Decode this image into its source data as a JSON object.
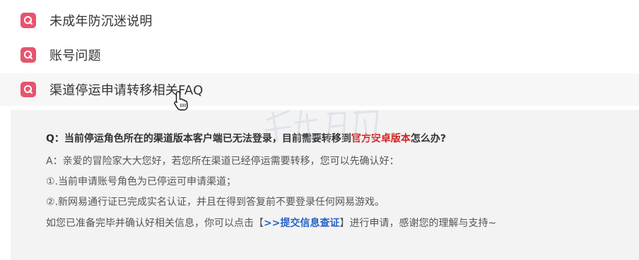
{
  "faq": {
    "items": [
      {
        "badge": "Q",
        "title": "未成年防沉迷说明"
      },
      {
        "badge": "Q",
        "title": "账号问题"
      },
      {
        "badge": "Q",
        "title": "渠道停运申请转移相关FAQ"
      }
    ]
  },
  "answer": {
    "question_prefix": "Q：当前停运角色所在的渠道版本客户端已无法登录，目前需要转移到",
    "question_highlight": "官方安卓版本",
    "question_suffix": "怎么办?",
    "line1": "A：亲爱的冒险家大大您好，若您所在渠道已经停运需要转移，您可以先确认好：",
    "line2": "①.当前申请账号角色为已停运可申请渠道；",
    "line3": "②.新网易通行证已完成实名认证，并且在得到答复前不要登录任何网易游戏。",
    "line4_prefix": "如您已准备完毕并确认好相关信息，你可以点击",
    "line4_bracket_open": "【",
    "line4_link": ">>提交信息查证",
    "line4_bracket_close": "】",
    "line4_suffix": "进行申请，感谢您的理解与支持~"
  },
  "colors": {
    "badge": "#e7546e",
    "highlight": "#d81e1e",
    "link": "#2a62c9",
    "panel_bg": "#f3f3f3"
  },
  "icons": {
    "badge_icon": "q-badge-icon",
    "cursor": "hand-pointer-icon"
  }
}
